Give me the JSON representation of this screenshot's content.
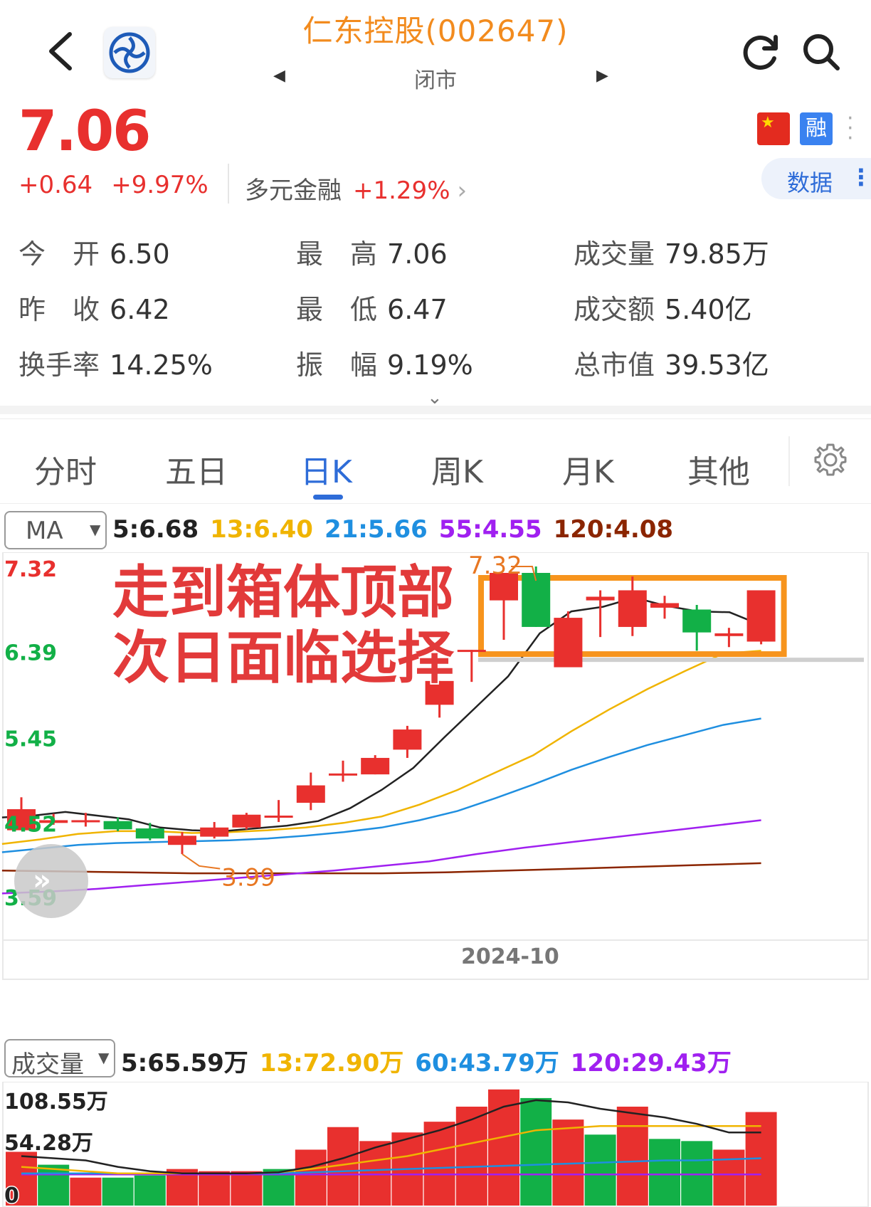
{
  "header": {
    "title": "仁东控股(002647)",
    "status": "闭市",
    "prev_arrow": "◀",
    "next_arrow": "▶"
  },
  "quote": {
    "price": "7.06",
    "change": "+0.64",
    "change_pct": "+9.97%",
    "sector_name": "多元金融",
    "sector_pct": "+1.29%",
    "flag_icon": "china-flag-icon",
    "margin_badge": "融",
    "data_button": "数据"
  },
  "stats": [
    {
      "label": "今　开",
      "value": "6.50"
    },
    {
      "label": "最　高",
      "value": "7.06"
    },
    {
      "label": "成交量",
      "value": "79.85万"
    },
    {
      "label": "昨　收",
      "value": "6.42"
    },
    {
      "label": "最　低",
      "value": "6.47"
    },
    {
      "label": "成交额",
      "value": "5.40亿"
    },
    {
      "label": "换手率",
      "value": "14.25%"
    },
    {
      "label": "振　幅",
      "value": "9.19%"
    },
    {
      "label": "总市值",
      "value": "39.53亿"
    }
  ],
  "tabs": [
    "分时",
    "五日",
    "日K",
    "周K",
    "月K",
    "其他"
  ],
  "active_tab": "日K",
  "ma_select": "MA",
  "ma_legend": [
    {
      "text": "5:6.68",
      "color": "#222222"
    },
    {
      "text": "13:6.40",
      "color": "#f0b400"
    },
    {
      "text": "21:5.66",
      "color": "#1f8fe0"
    },
    {
      "text": "55:4.55",
      "color": "#a020f0"
    },
    {
      "text": "120:4.08",
      "color": "#8b2500"
    }
  ],
  "vol_select": "成交量",
  "vol_legend": [
    {
      "text": "5:65.59万",
      "color": "#222222"
    },
    {
      "text": "13:72.90万",
      "color": "#f0b400"
    },
    {
      "text": "60:43.79万",
      "color": "#1f8fe0"
    },
    {
      "text": "120:29.43万",
      "color": "#a020f0"
    }
  ],
  "colors": {
    "up": "#e8302e",
    "down": "#12b047",
    "accent": "#2e6cd8",
    "box": "#f7941d",
    "title": "#f28b1e"
  },
  "chart_data": {
    "type": "candlestick",
    "annotation": [
      "走到箱体顶部",
      "次日面临选择"
    ],
    "x_label": "2024-10",
    "y_ticks": [
      "7.32",
      "6.39",
      "5.45",
      "4.52",
      "3.59"
    ],
    "y_tick_colors": [
      "#e8302e",
      "#12b047",
      "#12b047",
      "#12b047",
      "#12b047"
    ],
    "ylim": [
      3.59,
      7.32
    ],
    "high_label": "7.32",
    "low_label": "3.99",
    "candles": [
      {
        "o": 4.44,
        "c": 4.67,
        "h": 4.8,
        "l": 4.44
      },
      {
        "o": 4.52,
        "c": 4.55,
        "h": 4.62,
        "l": 4.5
      },
      {
        "o": 4.53,
        "c": 4.55,
        "h": 4.63,
        "l": 4.48
      },
      {
        "o": 4.54,
        "c": 4.45,
        "h": 4.58,
        "l": 4.43
      },
      {
        "o": 4.46,
        "c": 4.35,
        "h": 4.52,
        "l": 4.33
      },
      {
        "o": 4.28,
        "c": 4.38,
        "h": 4.42,
        "l": 4.18
      },
      {
        "o": 4.37,
        "c": 4.47,
        "h": 4.53,
        "l": 4.35
      },
      {
        "o": 4.47,
        "c": 4.61,
        "h": 4.63,
        "l": 4.45
      },
      {
        "o": 4.59,
        "c": 4.6,
        "h": 4.77,
        "l": 4.53
      },
      {
        "o": 4.74,
        "c": 4.93,
        "h": 5.07,
        "l": 4.66
      },
      {
        "o": 5.05,
        "c": 5.06,
        "h": 5.2,
        "l": 4.97
      },
      {
        "o": 5.05,
        "c": 5.23,
        "h": 5.26,
        "l": 5.05
      },
      {
        "o": 5.32,
        "c": 5.54,
        "h": 5.58,
        "l": 5.23
      },
      {
        "o": 5.81,
        "c": 6.07,
        "h": 6.07,
        "l": 5.67
      },
      {
        "o": 6.41,
        "c": 6.41,
        "h": 6.41,
        "l": 6.06
      },
      {
        "o": 6.95,
        "c": 7.25,
        "h": 7.25,
        "l": 6.52
      },
      {
        "o": 7.25,
        "c": 6.66,
        "h": 7.32,
        "l": 6.66
      },
      {
        "o": 6.22,
        "c": 6.76,
        "h": 6.83,
        "l": 6.22
      },
      {
        "o": 6.95,
        "c": 6.99,
        "h": 7.06,
        "l": 6.55
      },
      {
        "o": 6.66,
        "c": 7.06,
        "h": 7.21,
        "l": 6.56
      },
      {
        "o": 6.87,
        "c": 6.92,
        "h": 7.0,
        "l": 6.75
      },
      {
        "o": 6.85,
        "c": 6.6,
        "h": 6.9,
        "l": 6.4
      },
      {
        "o": 6.56,
        "c": 6.59,
        "h": 6.65,
        "l": 6.44
      },
      {
        "o": 6.5,
        "c": 7.06,
        "h": 7.06,
        "l": 6.47
      }
    ],
    "ma5": [
      4.58,
      4.6,
      4.64,
      4.6,
      4.56,
      4.47,
      4.44,
      4.43,
      4.46,
      4.49,
      4.54,
      4.68,
      4.88,
      5.12,
      5.46,
      5.79,
      6.12,
      6.59,
      6.83,
      6.88,
      6.98,
      6.89,
      6.83,
      6.82,
      6.68
    ],
    "ma13": [
      4.29,
      4.34,
      4.4,
      4.43,
      4.43,
      4.41,
      4.42,
      4.44,
      4.47,
      4.52,
      4.59,
      4.72,
      4.88,
      5.07,
      5.26,
      5.52,
      5.76,
      5.98,
      6.18,
      6.37,
      6.4
    ],
    "ma21": [
      4.2,
      4.24,
      4.28,
      4.3,
      4.31,
      4.32,
      4.33,
      4.35,
      4.38,
      4.42,
      4.47,
      4.55,
      4.65,
      4.79,
      4.94,
      5.1,
      5.24,
      5.37,
      5.48,
      5.59,
      5.66
    ],
    "ma55": [
      3.75,
      3.77,
      3.8,
      3.84,
      3.88,
      3.92,
      3.96,
      4.0,
      4.05,
      4.1,
      4.18,
      4.25,
      4.31,
      4.37,
      4.43,
      4.49,
      4.55
    ],
    "ma120": [
      4.0,
      3.99,
      3.98,
      3.97,
      3.97,
      3.97,
      3.97,
      3.98,
      4.0,
      4.02,
      4.04,
      4.06,
      4.08
    ],
    "volume": {
      "y_ticks": [
        "108.55万",
        "54.28万",
        "0"
      ],
      "max": 108.55,
      "bars": [
        {
          "v": 50,
          "up": true
        },
        {
          "v": 38,
          "up": false
        },
        {
          "v": 26,
          "up": true
        },
        {
          "v": 26,
          "up": false
        },
        {
          "v": 28,
          "up": false
        },
        {
          "v": 34,
          "up": true
        },
        {
          "v": 32,
          "up": true
        },
        {
          "v": 32,
          "up": true
        },
        {
          "v": 34,
          "up": false
        },
        {
          "v": 52,
          "up": true
        },
        {
          "v": 73,
          "up": true
        },
        {
          "v": 60,
          "up": true
        },
        {
          "v": 68,
          "up": true
        },
        {
          "v": 78,
          "up": true
        },
        {
          "v": 92,
          "up": true
        },
        {
          "v": 108,
          "up": true
        },
        {
          "v": 100,
          "up": false
        },
        {
          "v": 80,
          "up": true
        },
        {
          "v": 66,
          "up": false
        },
        {
          "v": 92,
          "up": true
        },
        {
          "v": 62,
          "up": false
        },
        {
          "v": 60,
          "up": false
        },
        {
          "v": 52,
          "up": true
        },
        {
          "v": 87,
          "up": true
        }
      ],
      "ma5": [
        46,
        44,
        42,
        36,
        32,
        30,
        30,
        30,
        31,
        36,
        44,
        54,
        62,
        70,
        80,
        92,
        98,
        96,
        90,
        86,
        82,
        76,
        68,
        68
      ],
      "ma13": [
        36,
        34,
        32,
        30,
        30,
        30,
        30,
        30,
        31,
        34,
        38,
        42,
        46,
        52,
        58,
        64,
        70,
        72,
        74,
        74,
        74,
        74,
        74,
        74
      ],
      "ma60": [
        30,
        30,
        30,
        30,
        30,
        30,
        30,
        30,
        30,
        31,
        32,
        33,
        34,
        35,
        36,
        37,
        38,
        39,
        40,
        41,
        42,
        42,
        43,
        44
      ],
      "ma120": [
        29,
        29,
        29,
        29,
        29,
        29,
        29,
        29,
        29,
        29,
        29,
        29,
        29,
        29,
        29,
        29,
        29,
        29,
        29,
        29,
        29,
        29,
        29,
        29
      ]
    }
  }
}
